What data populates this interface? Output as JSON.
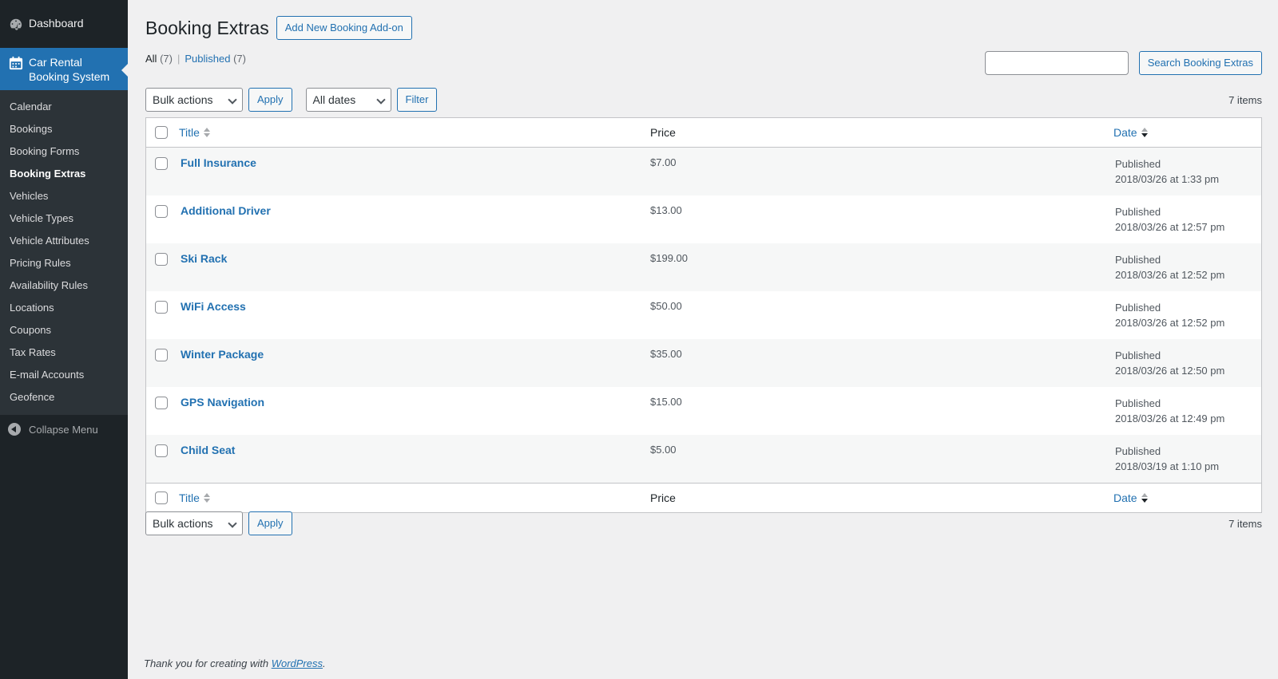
{
  "sidebar": {
    "dashboard": "Dashboard",
    "plugin_menu": [
      "Car Rental",
      "Booking System"
    ],
    "items": [
      {
        "label": "Calendar"
      },
      {
        "label": "Bookings"
      },
      {
        "label": "Booking Forms"
      },
      {
        "label": "Booking Extras",
        "current": true
      },
      {
        "label": "Vehicles"
      },
      {
        "label": "Vehicle Types"
      },
      {
        "label": "Vehicle Attributes"
      },
      {
        "label": "Pricing Rules"
      },
      {
        "label": "Availability Rules"
      },
      {
        "label": "Locations"
      },
      {
        "label": "Coupons"
      },
      {
        "label": "Tax Rates"
      },
      {
        "label": "E-mail Accounts"
      },
      {
        "label": "Geofence"
      }
    ],
    "collapse": "Collapse Menu"
  },
  "header": {
    "title": "Booking Extras",
    "add_new": "Add New Booking Add-on"
  },
  "filters": {
    "all_label": "All",
    "all_count": "(7)",
    "separator": "|",
    "published_label": "Published",
    "published_count": "(7)"
  },
  "search": {
    "value": "",
    "button": "Search Booking Extras"
  },
  "tablenav_top": {
    "bulk_actions": "Bulk actions",
    "apply": "Apply",
    "dates": "All dates",
    "filter": "Filter",
    "items": "7 items"
  },
  "tablenav_bottom": {
    "bulk_actions": "Bulk actions",
    "apply": "Apply",
    "items": "7 items"
  },
  "table": {
    "columns": {
      "title": "Title",
      "price": "Price",
      "date": "Date"
    },
    "rows": [
      {
        "title": "Full Insurance",
        "price": "$7.00",
        "status": "Published",
        "date": "2018/03/26 at 1:33 pm"
      },
      {
        "title": "Additional Driver",
        "price": "$13.00",
        "status": "Published",
        "date": "2018/03/26 at 12:57 pm"
      },
      {
        "title": "Ski Rack",
        "price": "$199.00",
        "status": "Published",
        "date": "2018/03/26 at 12:52 pm"
      },
      {
        "title": "WiFi Access",
        "price": "$50.00",
        "status": "Published",
        "date": "2018/03/26 at 12:52 pm"
      },
      {
        "title": "Winter Package",
        "price": "$35.00",
        "status": "Published",
        "date": "2018/03/26 at 12:50 pm"
      },
      {
        "title": "GPS Navigation",
        "price": "$15.00",
        "status": "Published",
        "date": "2018/03/26 at 12:49 pm"
      },
      {
        "title": "Child Seat",
        "price": "$5.00",
        "status": "Published",
        "date": "2018/03/19 at 1:10 pm"
      }
    ]
  },
  "footer": {
    "text_before": "Thank you for creating with ",
    "link": "WordPress",
    "text_after": "."
  },
  "colors": {
    "sidebar_bg": "#1d2327",
    "submenu_bg": "#2c3338",
    "accent": "#2271b1",
    "page_bg": "#f0f0f1"
  }
}
